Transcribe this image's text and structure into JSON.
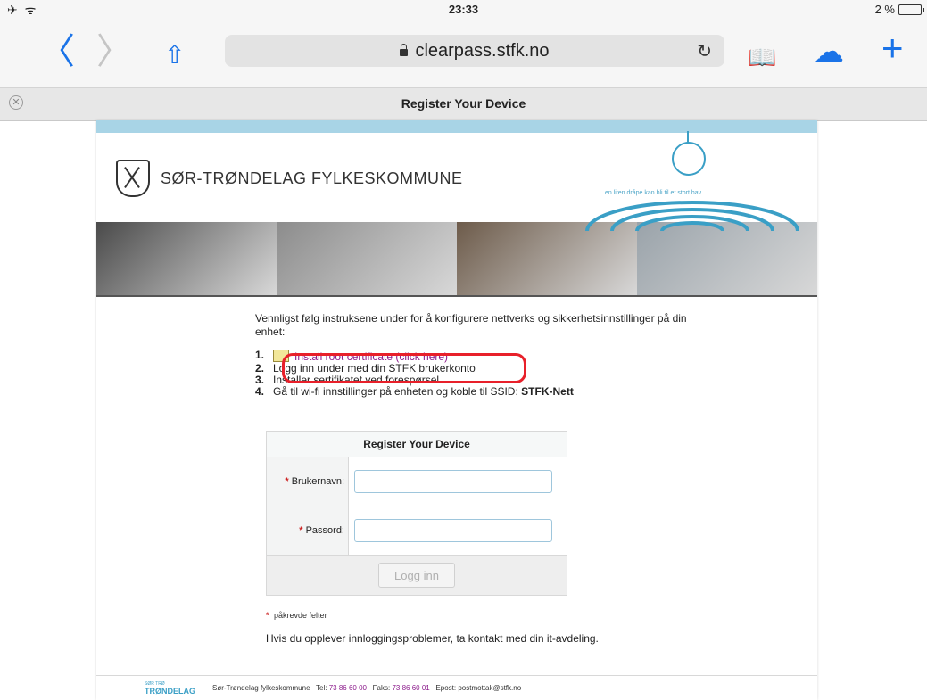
{
  "status": {
    "left": "✈ ᯤ",
    "time": "23:33",
    "battery": "2 %"
  },
  "toolbar": {
    "back": "〈",
    "forward": "〉",
    "share": "⇧",
    "url": "clearpass.stfk.no",
    "reload": "↻",
    "bookmarks": "📖",
    "cloud": "☁",
    "new_tab": "+"
  },
  "tab": {
    "close": "✕",
    "title": "Register Your Device"
  },
  "header": {
    "org": "SØR-TRØNDELAG FYLKESKOMMUNE",
    "slogan": "en liten dråpe kan bli til et stort hav"
  },
  "banner_colors": [
    "#4a4a4a",
    "#8c8c8c",
    "#6d5b4a",
    "#9aa3aa"
  ],
  "content": {
    "intro": "Vennligst følg instruksene under for å konfigurere nettverks og sikkerhetsinnstillinger på din enhet:",
    "steps": [
      {
        "n": "1.",
        "text": "Install root certificate (click here)"
      },
      {
        "n": "2.",
        "text": "Logg inn under med din STFK brukerkonto"
      },
      {
        "n": "3.",
        "text": "Installer sertifikatet ved forespørsel"
      },
      {
        "n": "4.",
        "text": "Gå til wi-fi innstillinger på enheten og koble til SSID:",
        "bold": "STFK-Nett"
      }
    ]
  },
  "form": {
    "title": "Register Your Device",
    "username_label": "Brukernavn:",
    "username_value": "",
    "password_label": "Passord:",
    "password_value": "",
    "submit": "Logg inn",
    "required_note": "påkrevde felter",
    "required_mark": "*"
  },
  "help": "Hvis du opplever innloggingsproblemer, ta kontakt med din it-avdeling.",
  "footer": {
    "logo_small": "SØR TRØ",
    "logo": "TRØNDELAG",
    "org": "Sør-Trøndelag fylkeskommune",
    "tel_label": "Tel:",
    "tel": "73 86 60 00",
    "fax_label": "Faks:",
    "fax": "73 86 60 01",
    "email_label": "Epost:",
    "email": "postmottak@stfk.no"
  }
}
